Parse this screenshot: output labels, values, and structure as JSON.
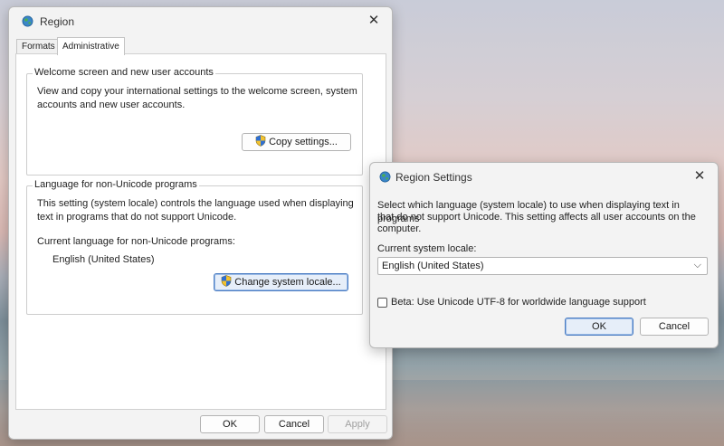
{
  "region_window": {
    "title": "Region",
    "tabs": [
      {
        "label": "Formats"
      },
      {
        "label": "Administrative"
      }
    ],
    "welcome_group": {
      "title": "Welcome screen and new user accounts",
      "description_line1": "View and copy your international settings to the welcome screen, system",
      "description_line2": "accounts and new user accounts.",
      "copy_button": "Copy settings..."
    },
    "unicode_group": {
      "title": "Language for non-Unicode programs",
      "description_line1": "This setting (system locale) controls the language used when displaying",
      "description_line2": "text in programs that do not support Unicode.",
      "current_label": "Current language for non-Unicode programs:",
      "current_value": "English (United States)",
      "change_button": "Change system locale..."
    },
    "footer": {
      "ok": "OK",
      "cancel": "Cancel",
      "apply": "Apply"
    }
  },
  "settings_dialog": {
    "title": "Region Settings",
    "description_line1": "Select which language (system locale) to use when displaying text in programs",
    "description_line2": "that do not support Unicode. This setting affects all user accounts on the",
    "description_line3": "computer.",
    "locale_label": "Current system locale:",
    "locale_value": "English (United States)",
    "beta_label": "Beta: Use Unicode UTF-8 for worldwide language support",
    "beta_checked": false,
    "ok": "OK",
    "cancel": "Cancel"
  },
  "icons": {
    "window_icon": "globe-icon",
    "shield_icon": "uac-shield-icon",
    "close_icon": "close-icon",
    "dropdown_icon": "chevron-down-icon"
  },
  "colors": {
    "focus_border": "#4a7cc2",
    "focus_fill": "#e6eef9"
  }
}
